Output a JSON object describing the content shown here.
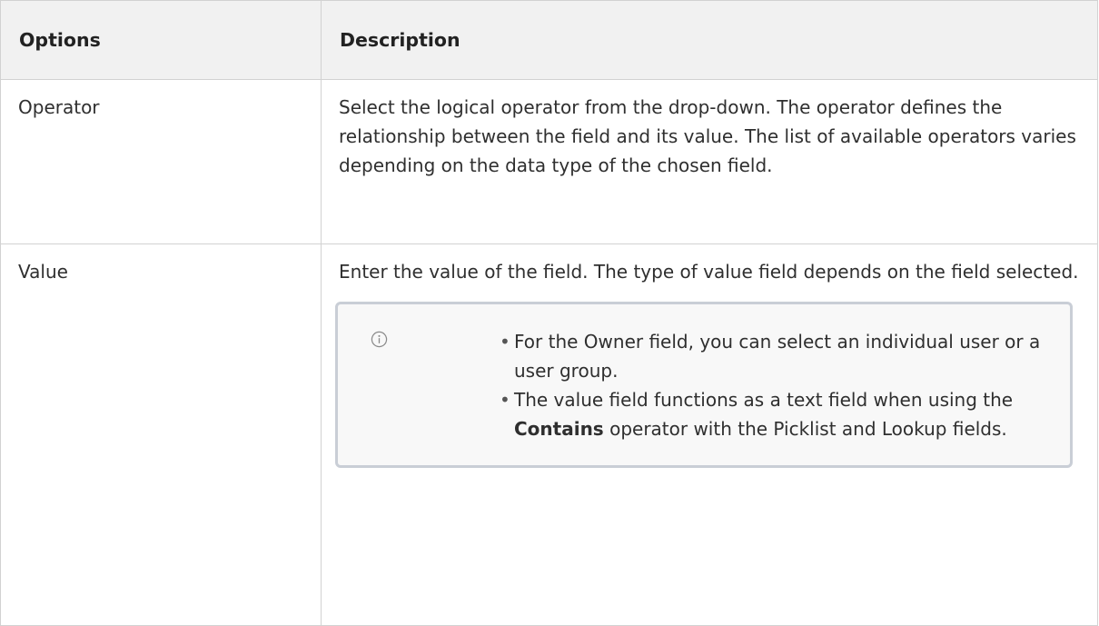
{
  "table": {
    "headers": {
      "options": "Options",
      "description": "Description"
    },
    "rows": [
      {
        "option": "Operator",
        "description": "Select the logical operator from the drop-down. The operator defines the relationship between the field and its value. The list of available operators varies depending on the data type of the chosen field."
      },
      {
        "option": "Value",
        "description": "Enter the value of the field. The type of value field depends on the field selected."
      }
    ]
  },
  "callout": {
    "icon": "info-icon",
    "border_color": "#c9ced6",
    "bullet_glyph": "•",
    "items": [
      {
        "text": "For the Owner field, you can select an individual user or a user group."
      },
      {
        "before": "The value field functions as a text field when using the ",
        "emphasis": "Contains",
        "after": " operator with the Picklist and Lookup fields."
      }
    ]
  }
}
